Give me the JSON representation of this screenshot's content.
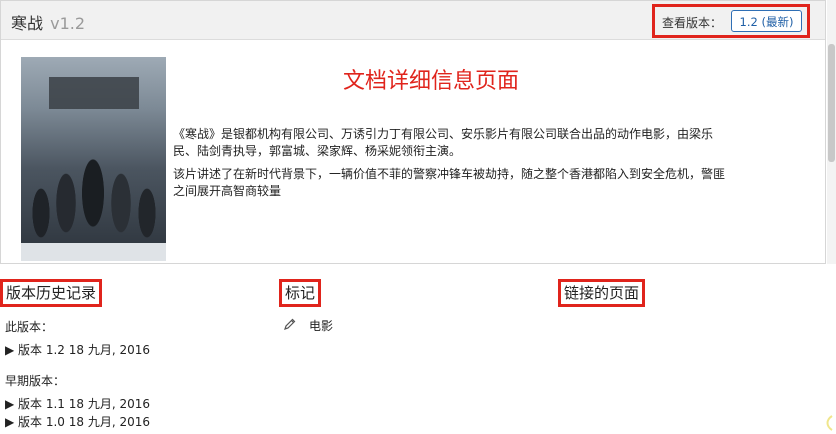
{
  "document": {
    "title": "寒战",
    "version": "v1.2",
    "heading": "文档详细信息页面",
    "description": [
      "《寒战》是银都机构有限公司、万诱引力丁有限公司、安乐影片有限公司联合出品的动作电影，由梁乐民、陆剑青执导，郭富城、梁家辉、杨采妮领衔主演。",
      "该片讲述了在新时代背景下，一辆价值不菲的警察冲锋车被劫持，随之整个香港都陷入到安全危机，警匪之间展开高智商较量"
    ]
  },
  "version_selector": {
    "label": "查看版本：",
    "selected": "1.2 (最新)"
  },
  "history": {
    "heading": "版本历史记录",
    "current_label": "此版本：",
    "current": "▶ 版本 1.2  18 九月, 2016",
    "earlier_label": "早期版本：",
    "earlier": [
      "▶ 版本 1.1  18 九月, 2016",
      "▶ 版本 1.0  18 九月, 2016"
    ]
  },
  "tags": {
    "heading": "标记",
    "items": [
      "电影"
    ]
  },
  "links": {
    "heading": "链接的页面"
  },
  "colors": {
    "highlight": "#e0241c",
    "link": "#1f5fa6"
  }
}
